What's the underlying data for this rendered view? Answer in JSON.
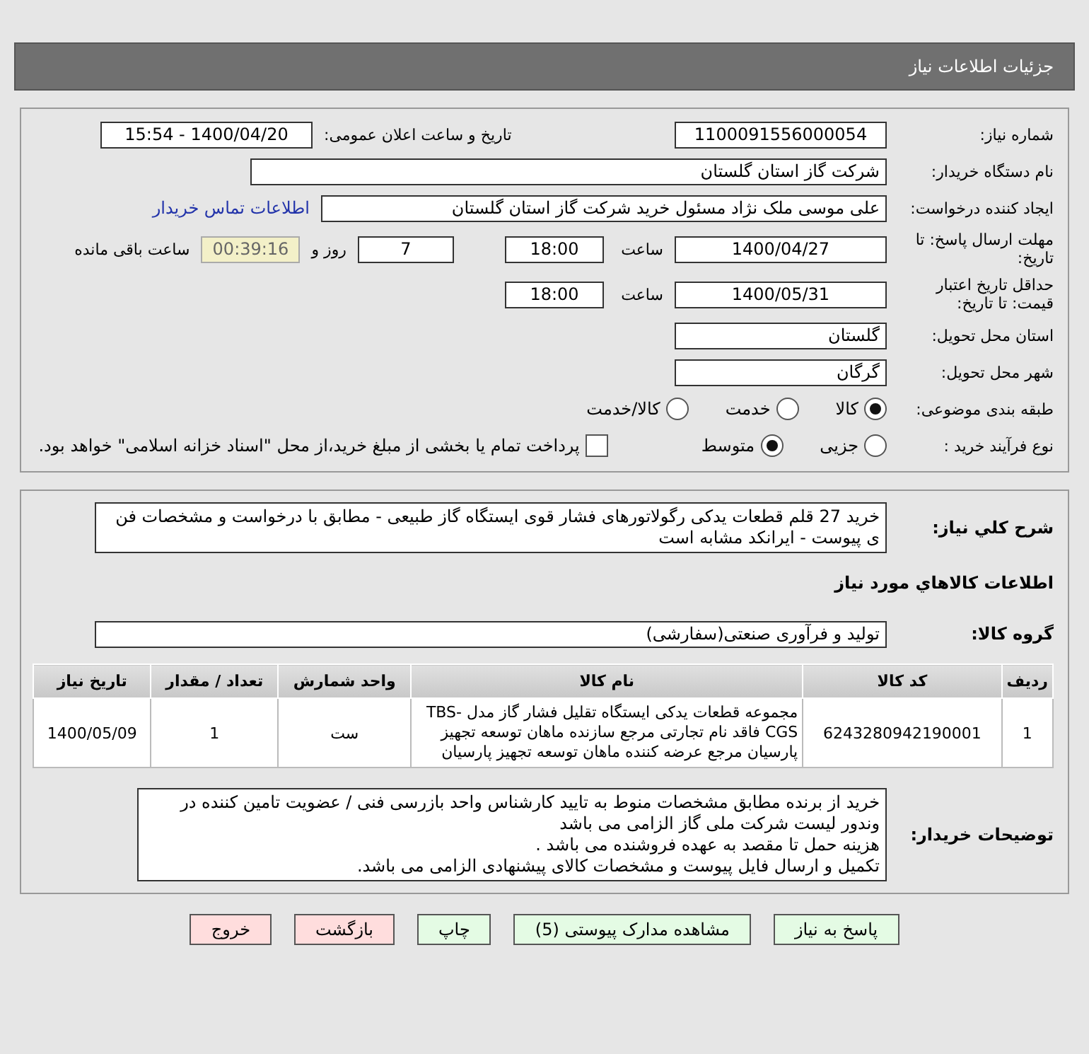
{
  "header": {
    "title": "جزئیات اطلاعات نیاز"
  },
  "details": {
    "need_number": {
      "label": "شماره نیاز:",
      "value": "1100091556000054"
    },
    "announce": {
      "label": "تاریخ و ساعت اعلان عمومی:",
      "value": "1400/04/20 - 15:54"
    },
    "buyer": {
      "label": "نام دستگاه خریدار:",
      "value": "شرکت گاز استان گلستان"
    },
    "creator": {
      "label": "ایجاد کننده درخواست:",
      "value": "علی موسی ملک نژاد مسئول خرید شرکت گاز استان گلستان",
      "link": "اطلاعات تماس خریدار"
    },
    "deadline": {
      "label": "مهلت ارسال پاسخ: تا تاریخ:",
      "date": "1400/04/27",
      "time_label": "ساعت",
      "time": "18:00",
      "days": "7",
      "days_label": "روز و",
      "remaining": "00:39:16",
      "remaining_label": "ساعت باقی مانده"
    },
    "validity": {
      "label": "حداقل تاریخ اعتبار قیمت: تا تاریخ:",
      "date": "1400/05/31",
      "time_label": "ساعت",
      "time": "18:00"
    },
    "province": {
      "label": "استان محل تحویل:",
      "value": "گلستان"
    },
    "city": {
      "label": "شهر محل تحویل:",
      "value": "گرگان"
    },
    "category": {
      "label": "طبقه بندی موضوعی:",
      "options": [
        {
          "label": "کالا",
          "selected": true
        },
        {
          "label": "خدمت",
          "selected": false
        },
        {
          "label": "کالا/خدمت",
          "selected": false
        }
      ]
    },
    "process": {
      "label": "نوع فرآیند خرید :",
      "options": [
        {
          "label": "جزیی",
          "selected": false
        },
        {
          "label": "متوسط",
          "selected": true
        }
      ],
      "treasury": {
        "checked": false,
        "label": "پرداخت تمام یا بخشی از مبلغ خرید،از محل \"اسناد خزانه اسلامی\" خواهد بود."
      }
    }
  },
  "needs": {
    "description": {
      "label": "شرح کلي نياز:",
      "value": "خرید 27 قلم قطعات یدکی رگولاتورهای فشار قوی ایستگاه گاز طبیعی - مطابق با درخواست و مشخصات فن ی پیوست  - ایرانکد مشابه است"
    },
    "items_title": "اطلاعات کالاهاي مورد نياز",
    "group": {
      "label": "گروه کالا:",
      "value": "تولید و فرآوری صنعتی(سفارشی)"
    },
    "table": {
      "columns": [
        "ردیف",
        "کد کالا",
        "نام کالا",
        "واحد شمارش",
        "تعداد / مقدار",
        "تاریخ نیاز"
      ],
      "rows": [
        [
          "1",
          "6243280942190001",
          "مجموعه قطعات یدکی ایستگاه تقلیل فشار گاز مدل TBS-CGS فاقد نام تجارتی مرجع سازنده ماهان توسعه تجهیز پارسیان مرجع عرضه کننده ماهان توسعه تجهیز پارسیان",
          "ست",
          "1",
          "1400/05/09"
        ]
      ]
    },
    "notes": {
      "label": "توضیحات خریدار:",
      "lines": [
        "خرید از برنده مطابق مشخصات منوط به تایید کارشناس واحد بازرسی فنی / عضویت تامین کننده در وندور لیست شرکت ملی گاز الزامی می باشد",
        "هزینه حمل تا مقصد به عهده فروشنده می باشد .",
        "تکمیل و ارسال فایل پیوست و مشخصات کالای پیشنهادی الزامی می باشد."
      ]
    }
  },
  "buttons": [
    {
      "label": "پاسخ به نیاز",
      "kind": "action"
    },
    {
      "label": "مشاهده مدارک پیوستی (5)",
      "kind": "action"
    },
    {
      "label": "چاپ",
      "kind": "action"
    },
    {
      "label": "بازگشت",
      "kind": "exit"
    },
    {
      "label": "خروج",
      "kind": "exit"
    }
  ]
}
